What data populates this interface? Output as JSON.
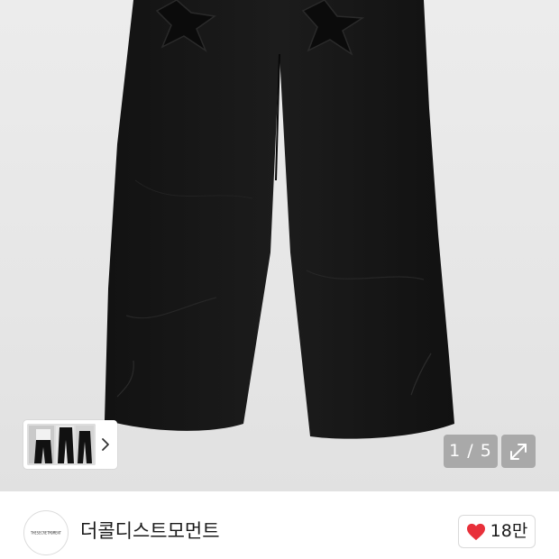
{
  "gallery": {
    "counter": "1 / 5",
    "product_image_icon": "black-wide-pants-with-star-patches",
    "thumbnail_icon": "product-thumbnails",
    "next_icon": "chevron-right-icon",
    "expand_icon": "expand-arrows-icon"
  },
  "shop": {
    "logo_text": "THESECRETMOMENT",
    "name": "더콜디스트모먼트",
    "likes": "18만",
    "like_icon": "heart-icon",
    "like_color": "#e8303a"
  }
}
